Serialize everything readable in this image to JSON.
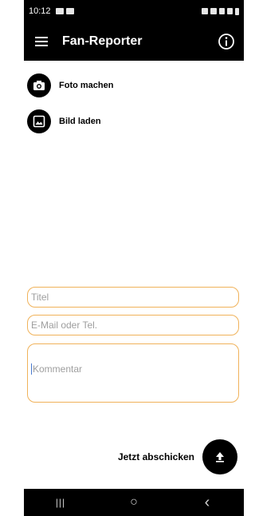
{
  "status_bar": {
    "time": "10:12"
  },
  "app_bar": {
    "title": "Fan-Reporter",
    "menu_icon": "hamburger-menu-icon",
    "info_icon": "info-icon"
  },
  "actions": [
    {
      "label": "Foto machen",
      "icon": "camera-icon"
    },
    {
      "label": "Bild laden",
      "icon": "image-icon"
    }
  ],
  "form": {
    "title_placeholder": "Titel",
    "contact_placeholder": "E-Mail oder Tel.",
    "comment_placeholder": "Kommentar",
    "submit_label": "Jetzt abschicken",
    "submit_icon": "upload-icon"
  },
  "nav_bar": {
    "recents": "|||",
    "home": "○",
    "back": "‹"
  },
  "colors": {
    "accent_border": "#f0b25a",
    "bar_background": "#000000"
  }
}
